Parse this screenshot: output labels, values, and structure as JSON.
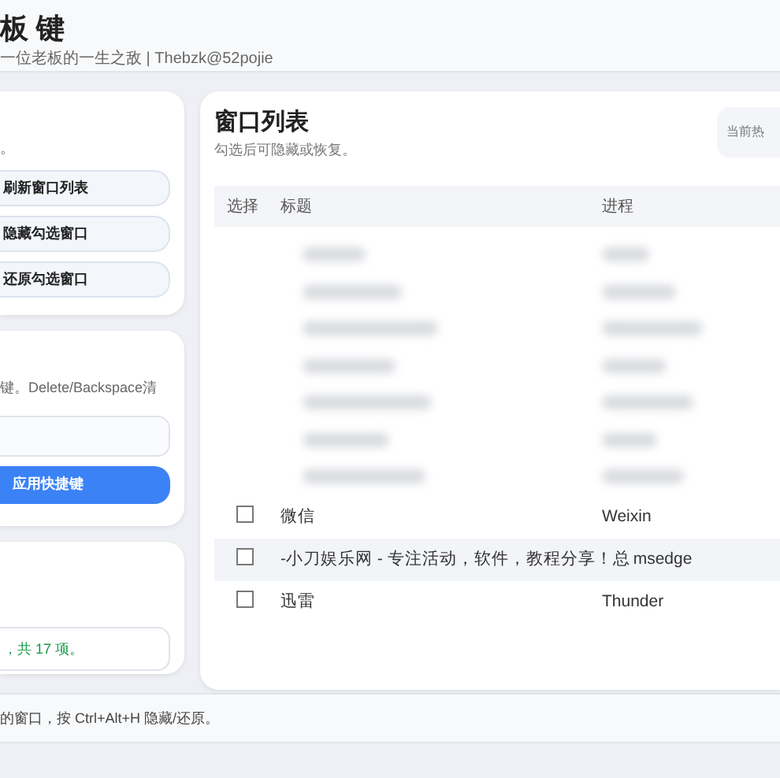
{
  "header": {
    "title": "板 键",
    "subtitle": "一位老板的一生之敌 | Thebzk@52pojie"
  },
  "left_panel": {
    "actions_card": {
      "note": "。",
      "buttons": [
        {
          "label": "刷新窗口列表"
        },
        {
          "label": "隐藏勾选窗口"
        },
        {
          "label": "还原勾选窗口"
        }
      ]
    },
    "hotkey_card": {
      "note": "键。Delete/Backspace清",
      "apply_button": "应用快捷键"
    },
    "status_card": {
      "message": "，共 17 项。"
    }
  },
  "window_list": {
    "title": "窗口列表",
    "subtitle": "勾选后可隐藏或恢复。",
    "hotkey_badge": "当前热",
    "columns": [
      "选择",
      "标题",
      "进程"
    ],
    "rows": [
      {
        "kind": "blurred"
      },
      {
        "kind": "blurred"
      },
      {
        "kind": "blurred"
      },
      {
        "kind": "blurred"
      },
      {
        "kind": "blurred"
      },
      {
        "kind": "blurred"
      },
      {
        "kind": "blurred"
      },
      {
        "kind": "window",
        "title": "微信",
        "process": "Weixin",
        "checked": false,
        "selected": false
      },
      {
        "kind": "window",
        "title": "-小刀娱乐网 - 专注活动，软件，教程分享！总",
        "process": "msedge",
        "checked": false,
        "selected": true
      },
      {
        "kind": "window",
        "title": "迅雷",
        "process": "Thunder",
        "checked": false,
        "selected": false
      }
    ]
  },
  "footer": {
    "text": "的窗口，按 Ctrl+Alt+H 隐藏/还原。"
  }
}
